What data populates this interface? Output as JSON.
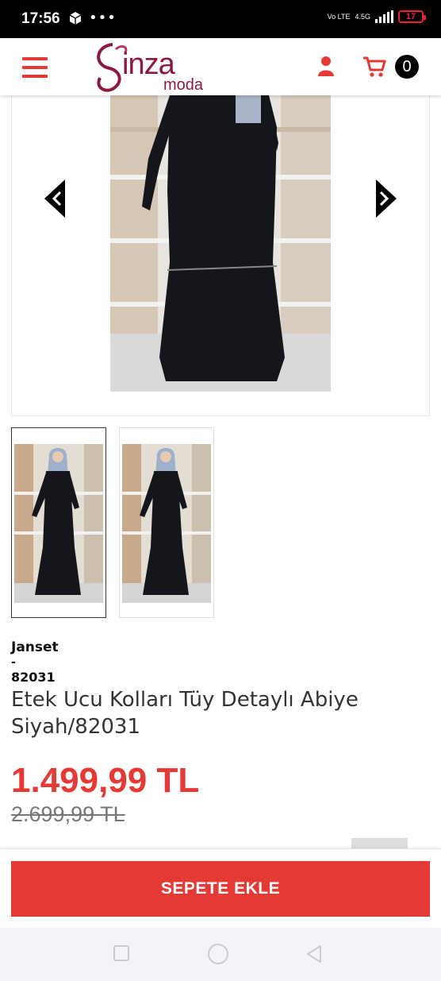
{
  "status_bar": {
    "time": "17:56",
    "notification_icons": [
      "box-icon",
      "more-icon"
    ],
    "network": "4.5G",
    "volte": "Vo LTE",
    "battery": "17"
  },
  "header": {
    "logo_main": "inza",
    "logo_sub": "moda",
    "cart_count": "0",
    "colors": {
      "accent": "#e53935",
      "logo": "#8b1a3e"
    }
  },
  "product": {
    "brand": "Janset",
    "separator": "-",
    "code": "82031",
    "title": "Etek Ucu Kolları Tüy Detaylı Abiye Siyah/82031",
    "price": "1.499,99 TL",
    "old_price": "2.699,99 TL"
  },
  "actions": {
    "add_to_cart": "SEPETE EKLE"
  }
}
